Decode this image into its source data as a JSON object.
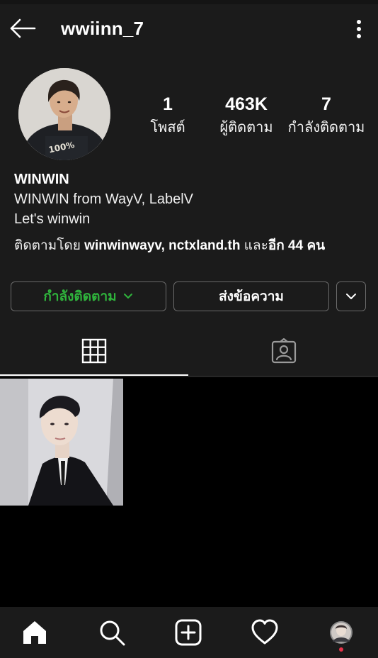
{
  "header": {
    "username": "wwiinn_7",
    "back_icon": "arrow-left-icon",
    "more_icon": "more-vertical-icon"
  },
  "stats": [
    {
      "value": "1",
      "label": "โพสต์"
    },
    {
      "value": "463K",
      "label": "ผู้ติดตาม"
    },
    {
      "value": "7",
      "label": "กำลังติดตาม"
    }
  ],
  "bio": {
    "name": "WINWIN",
    "lines": [
      "WINWIN from WayV, LabelV",
      "Let's winwin"
    ],
    "followed_by_prefix": "ติดตามโดย",
    "followed_by_user1": "winwinwayv",
    "followed_by_sep": ", ",
    "followed_by_user2": "nctxland.th",
    "followed_by_middle": " และ",
    "followed_by_others": "อีก 44 คน"
  },
  "actions": {
    "following_label": "กำลังติดตาม",
    "message_label": "ส่งข้อความ"
  },
  "tabs": [
    {
      "name": "posts-grid",
      "icon": "grid-icon",
      "active": true
    },
    {
      "name": "tagged",
      "icon": "tagged-person-icon",
      "active": false
    }
  ],
  "bottom_nav": [
    {
      "name": "home",
      "icon": "home-icon"
    },
    {
      "name": "search",
      "icon": "search-icon"
    },
    {
      "name": "new-post",
      "icon": "plus-square-icon"
    },
    {
      "name": "activity",
      "icon": "heart-icon"
    },
    {
      "name": "profile",
      "icon": "profile-avatar-icon"
    }
  ],
  "colors": {
    "background": "#000000",
    "surface": "#1b1b1b",
    "following_green": "#2fb43c",
    "notification_dot": "#e8334a"
  }
}
